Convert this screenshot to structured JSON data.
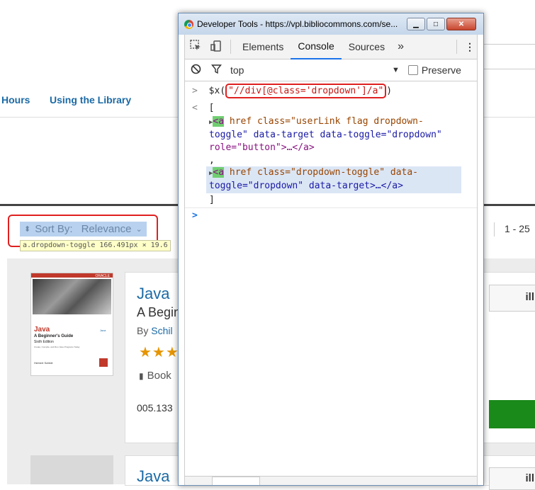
{
  "background": {
    "nav": [
      "Hours",
      "Using the Library"
    ],
    "sort": {
      "label": "Sort By:",
      "value": "Relevance"
    },
    "tooltip": "a.dropdown-toggle 166.491px × 19.6",
    "pagination": "1 - 25",
    "results": [
      {
        "cover": {
          "brand": "ORACLE",
          "title": "Java",
          "subtitle": "A Beginner's Guide",
          "edition": "Sixth Edition",
          "tagline": "Create, Compile, and Run Java Programs Today",
          "author": "Herbert Schildt",
          "java_mark": "Java"
        },
        "title": "Java",
        "subtitle": "A Begin",
        "by_prefix": "By",
        "author": "Schil",
        "stars": "★★★",
        "format": "Book",
        "call_number": "005.133"
      },
      {
        "title": "Java"
      }
    ],
    "right_icon": "ill"
  },
  "devtools": {
    "title": "Developer Tools - https://vpl.bibliocommons.com/se...",
    "window_buttons": {
      "minimize": "▁",
      "maximize": "□",
      "close": "✕"
    },
    "tabs": [
      "Elements",
      "Console",
      "Sources"
    ],
    "more_tabs": "»",
    "active_tab": "Console",
    "context": "top",
    "preserve_log": "Preserve",
    "console": {
      "input_prompt": ">",
      "output_prompt": "<",
      "call_fn": "$x(",
      "call_arg": "\"//div[@class='dropdown']/a\"",
      "call_close": ")",
      "open_bracket": "[",
      "close_bracket": "]",
      "separator": ",",
      "item1": {
        "line1_tag": "<a",
        "line1_rest": " href class=\"userLink flag dropdown-",
        "line2": "toggle\" data-target data-toggle=\"dropdown\"",
        "line3": "role=\"button\">…</a>"
      },
      "item2": {
        "line1_tag": "<a",
        "line1_rest": " href class=\"dropdown-toggle\" data-",
        "line2": "toggle=\"dropdown\" data-target>…</a>"
      },
      "empty_prompt": ">"
    },
    "icons": {
      "inspect": "inspect-icon",
      "device": "device-toolbar-icon",
      "clear": "clear-console-icon",
      "filter": "filter-icon",
      "menu": "kebab-menu-icon",
      "chrome": "chrome-logo-icon"
    }
  }
}
